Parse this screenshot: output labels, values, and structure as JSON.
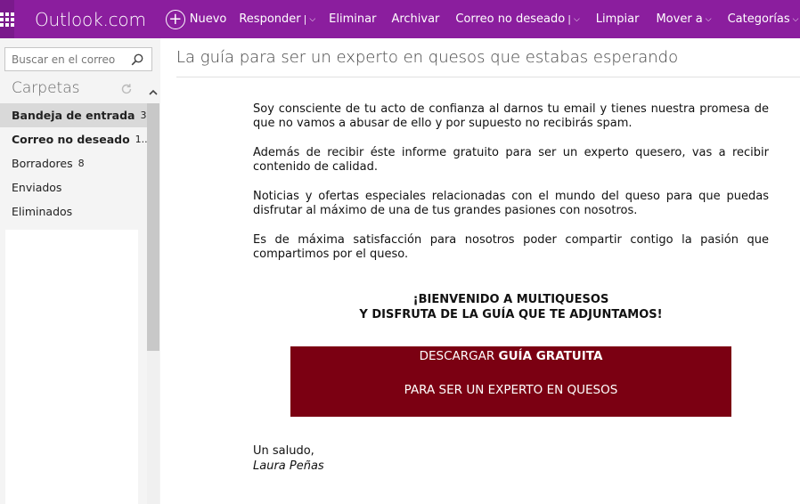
{
  "topbar": {
    "brand": "Outlook.com",
    "new_label": "Nuevo",
    "reply_label": "Responder",
    "delete_label": "Eliminar",
    "archive_label": "Archivar",
    "junk_label": "Correo no deseado",
    "sweep_label": "Limpiar",
    "move_label": "Mover a",
    "categories_label": "Categorías",
    "more_label": "···",
    "color": "#8b1e9e"
  },
  "sidebar": {
    "search_placeholder": "Buscar en el correo",
    "folders_title": "Carpetas",
    "folders": [
      {
        "label": "Bandeja de entrada",
        "count": "3"
      },
      {
        "label": "Correo no deseado",
        "count": "1..."
      },
      {
        "label": "Borradores",
        "count": "8"
      },
      {
        "label": "Enviados",
        "count": ""
      },
      {
        "label": "Eliminados",
        "count": ""
      }
    ]
  },
  "message": {
    "subject": "La guía para ser un experto en quesos que estabas esperando",
    "paragraphs": [
      "Soy consciente de tu acto de confianza al darnos tu email y tienes nuestra promesa de que no vamos a abusar de ello y por supuesto no recibirás spam.",
      "Además de recibir éste informe gratuito para ser un experto quesero, vas a recibir contenido de calidad.",
      "Noticias y ofertas especiales relacionadas con el mundo del queso para que puedas disfrutar al máximo de una de tus grandes pasiones con nosotros.",
      "Es de máxima satisfacción para nosotros poder compartir contigo la pasión que compartimos por el queso."
    ],
    "welcome_line1": "¡BIENVENIDO A MULTIQUESOS",
    "welcome_line2": "Y DISFRUTA DE LA GUÍA QUE TE ADJUNTAMOS!",
    "download_prefix": "DESCARGAR ",
    "download_bold": "GUÍA GRATUITA",
    "download_line2": "PARA SER UN EXPERTO EN QUESOS",
    "download_color": "#7b0012",
    "greeting": "Un saludo,",
    "signature": "Laura Peñas"
  }
}
